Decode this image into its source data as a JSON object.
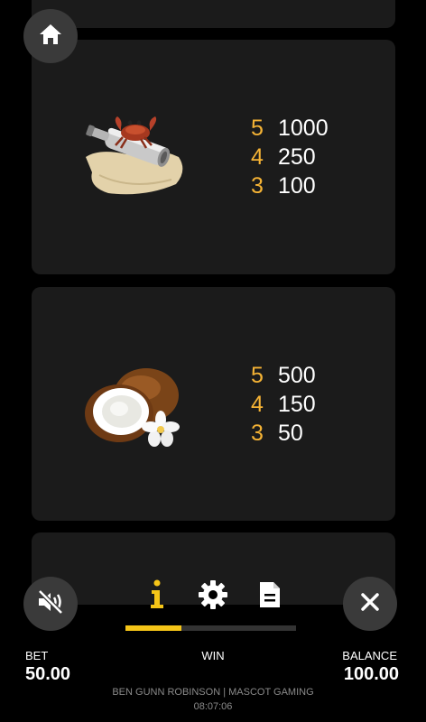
{
  "paytable": {
    "symbols": [
      {
        "name": "crab-on-bottle-symbol",
        "payouts": [
          {
            "count": "5",
            "value": "1000"
          },
          {
            "count": "4",
            "value": "250"
          },
          {
            "count": "3",
            "value": "100"
          }
        ]
      },
      {
        "name": "coconut-symbol",
        "payouts": [
          {
            "count": "5",
            "value": "500"
          },
          {
            "count": "4",
            "value": "150"
          },
          {
            "count": "3",
            "value": "50"
          }
        ]
      }
    ]
  },
  "menu": {
    "tabs": [
      {
        "icon": "info-icon",
        "active": true
      },
      {
        "icon": "gear-icon",
        "active": false
      },
      {
        "icon": "document-icon",
        "active": false
      }
    ],
    "progress_fraction": 0.33,
    "accent_color": "#f5c518"
  },
  "buttons": {
    "home_icon": "home-icon",
    "sound_icon": "sound-muted-icon",
    "close_icon": "close-icon"
  },
  "footer": {
    "bet_label": "BET",
    "bet_value": "50.00",
    "win_label": "WIN",
    "balance_label": "BALANCE",
    "balance_value": "100.00",
    "credits": "BEN GUNN ROBINSON | MASCOT GAMING",
    "clock": "08:07:06"
  }
}
